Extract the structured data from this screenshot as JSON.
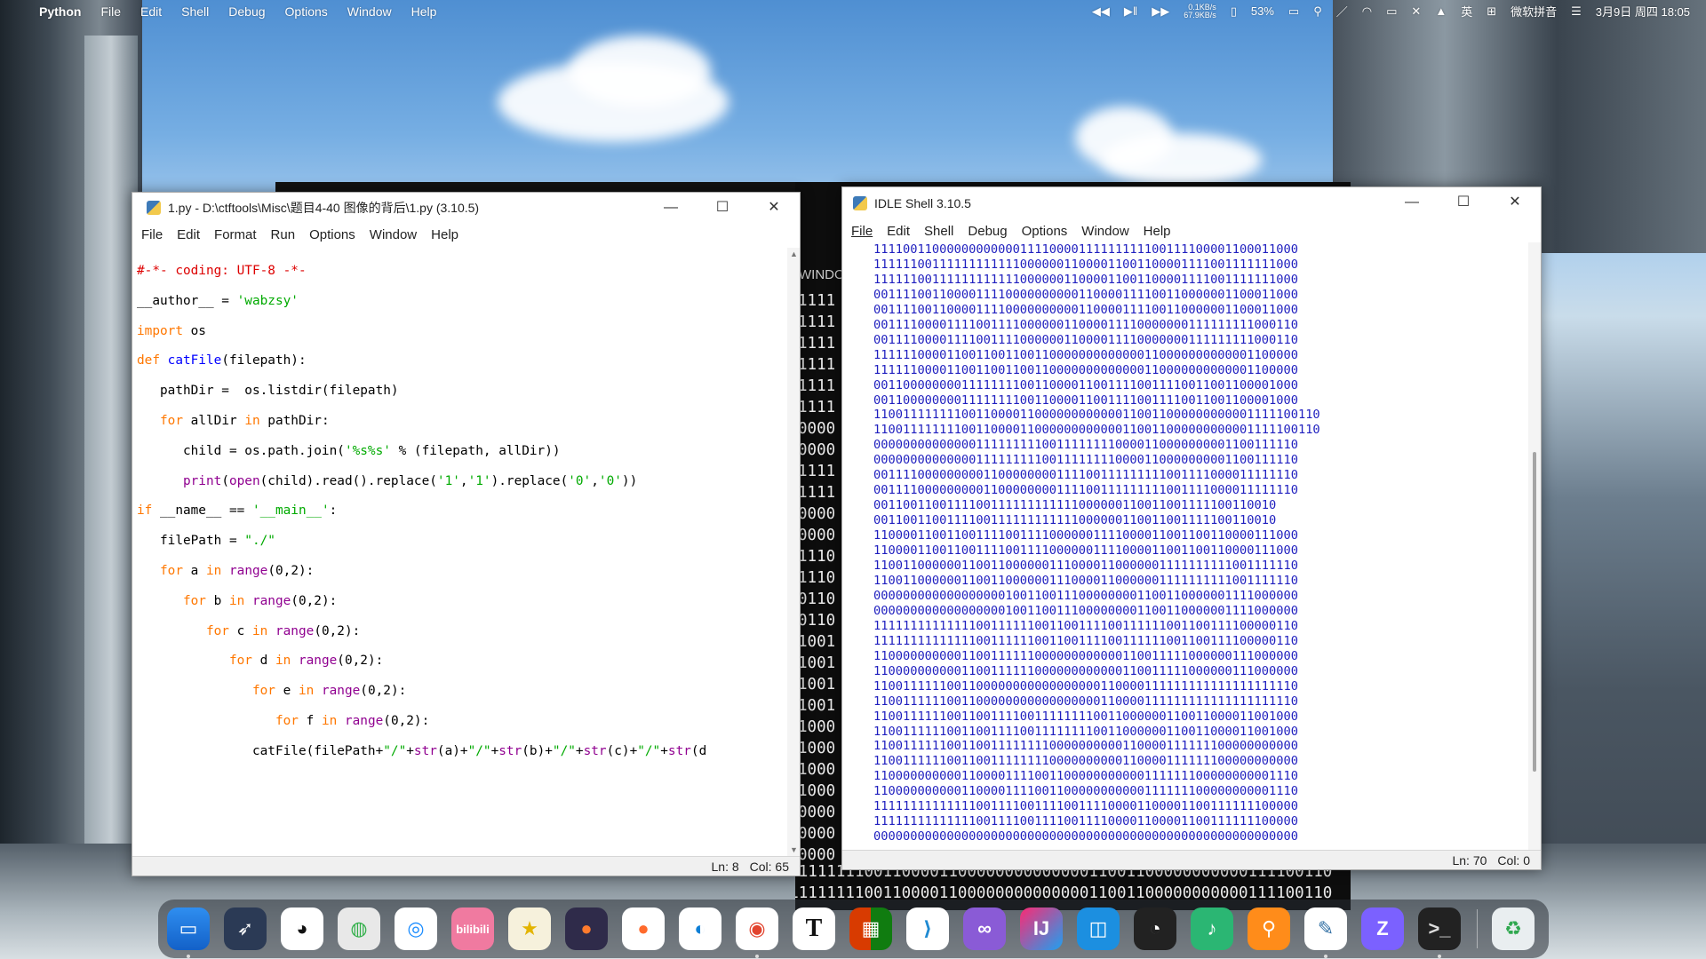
{
  "menubar": {
    "app": "Python",
    "items": [
      "File",
      "Edit",
      "Shell",
      "Debug",
      "Options",
      "Window",
      "Help"
    ],
    "net_up": "0.1KB/s",
    "net_down": "67.9KB/s",
    "battery": "53%",
    "lang": "英",
    "ime": "微软拼音",
    "datetime": "3月9日 周四 18:05"
  },
  "terminal": {
    "title": "WINDO",
    "lines": [
      "1111",
      "1111",
      "1111",
      "1111",
      "1111",
      "1111",
      "0000",
      "0000",
      "1111",
      "1111",
      "0000",
      "0000",
      "1110",
      "1110",
      "0110",
      "0110",
      "1001",
      "1001",
      "1001",
      "1001",
      "1000",
      "1000",
      "1000",
      "1000",
      "0000",
      "0000",
      "0000"
    ],
    "bottom_lines": [
      "1100111111111100110000110000000000000011001100000000000111100110",
      "1100111111111100110000110000000000000011001100000000000111100110"
    ]
  },
  "editor": {
    "title": "1.py - D:\\ctftools\\Misc\\题目4-40 图像的背后\\1.py (3.10.5)",
    "menu": [
      "File",
      "Edit",
      "Format",
      "Run",
      "Options",
      "Window",
      "Help"
    ],
    "code": {
      "l1": "#-*- coding: UTF-8 -*-",
      "l2a": "__author__ = ",
      "l2b": "'wabzsy'",
      "l3a": "import",
      "l3b": " os",
      "l4a": "def ",
      "l4b": "catFile",
      "l4c": "(filepath):",
      "l5": "   pathDir =  os.listdir(filepath)",
      "l6a": "   ",
      "l6b": "for",
      "l6c": " allDir ",
      "l6d": "in",
      "l6e": " pathDir:",
      "l7": "      child = os.path.join(",
      "l7s": "'%s%s'",
      "l7e": " % (filepath, allDir))",
      "l8a": "      ",
      "l8b": "print",
      "l8c": "(",
      "l8d": "open",
      "l8e": "(child).read().replace(",
      "l8f": "'1'",
      "l8g": ",",
      "l8h": "'1'",
      "l8i": ").replace(",
      "l8j": "'0'",
      "l8k": ",",
      "l8l": "'0'",
      "l8m": "))",
      "l9a": "if",
      "l9b": " __name__ == ",
      "l9c": "'__main__'",
      "l9d": ":",
      "l10a": "   filePath = ",
      "l10b": "\"./\"",
      "l11": "for",
      "l12": "for",
      "l13": "for",
      "l14": "for",
      "l15": "for",
      "l16": "for",
      "in": "in",
      "range": "range",
      "v11": " a ",
      "v12": " b ",
      "v13": " c ",
      "v14": " d ",
      "v15": " e ",
      "v16": " f ",
      "r": "(0,2):",
      "l17a": "               catFile(filePath+",
      "l17b": "\"/\"",
      "l17c": "+",
      "l17d": "str",
      "l17e": "(a)+",
      "l17f": "\"/\"",
      "l17g": "+",
      "l17h": "str",
      "l17i": "(b)+",
      "l17j": "\"/\"",
      "l17k": "+",
      "l17l": "str",
      "l17m": "(c)+",
      "l17n": "\"/\"",
      "l17o": "+",
      "l17p": "str",
      "l17q": "(d"
    },
    "ln": "Ln: 8",
    "col": "Col: 65"
  },
  "shell": {
    "title": "IDLE Shell 3.10.5",
    "menu": [
      "File",
      "Edit",
      "Shell",
      "Debug",
      "Options",
      "Window",
      "Help"
    ],
    "lines": [
      "1111001100000000000011110000111111111100111100001100011000",
      "1111110011111111111100000011000011001100001111001111111000",
      "1111110011111111111100000011000011001100001111001111111000",
      "0011110011000011110000000000110000111100110000001100011000",
      "0011110011000011110000000000110000111100110000001100011000",
      "0011110000111100111100000011000011110000000111111111000110",
      "0011110000111100111100000011000011110000000111111111000110",
      "1111110000110011001100110000000000000110000000000001100000",
      "1111110000110011001100110000000000000110000000000001100000",
      "0011000000001111111100110000110011110011110011001100001000",
      "0011000000001111111100110000110011110011110011001100001000",
      "1100111111110011000011000000000000110011000000000001111100110",
      "1100111111110011000011000000000000110011000000000001111100110",
      "0000000000000011111111100111111110000110000000001100111110",
      "0000000000000011111111100111111110000110000000001100111110",
      "0011110000000001100000000111100111111111001111000011111110",
      "0011110000000001100000000111100111111111001111000011111110",
      "0011001100111100111111111111000000110011001111100110010",
      "0011001100111100111111111111000000110011001111100110010",
      "1100001100110011110011110000001111000011001100110000111000",
      "1100001100110011110011110000001111000011001100110000111000",
      "1100110000001100110000001110000110000001111111111001111110",
      "1100110000001100110000001110000110000001111111111001111110",
      "0000000000000000001001100111000000001100110000001111000000",
      "0000000000000000001001100111000000001100110000001111000000",
      "1111111111111100111111001100111100111111001100111100000110",
      "1111111111111100111111001100111100111111001100111100000110",
      "1100000000001100111111000000000000110011111000000111000000",
      "1100000000001100111111000000000000110011111000000111000000",
      "1100111111001100000000000000000110000111111111111111111110",
      "1100111111001100000000000000000110000111111111111111111110",
      "1100111111001100111100111111110011000000110011000011001000",
      "1100111111001100111100111111110011000000110011000011001000",
      "1100111111001100111111110000000000110000111111100000000000",
      "1100111111001100111111110000000000110000111111100000000000",
      "1100000000001100001111001100000000000111111100000000001110",
      "1100000000001100001111001100000000000111111100000000001110",
      "1111111111111100111100111100111100001100001100111111100000",
      "1111111111111100111100111100111100001100001100111111100000",
      "0000000000000000000000000000000000000000000000000000000000"
    ],
    "ln": "Ln: 70",
    "col": "Col: 0"
  },
  "dock": [
    "finder",
    "launchpad",
    "qq",
    "wechat",
    "qq-browser",
    "bilibili",
    "notes",
    "firefox",
    "firefox-alt",
    "edge",
    "chrome",
    "typora",
    "office",
    "vscode",
    "visual-studio",
    "intellij",
    "snipaste",
    "obs",
    "music",
    "search",
    "python",
    "zed",
    "terminal",
    "recycle-bin"
  ],
  "dock_labels": {
    "bili": "bilibili",
    "typora": "T"
  }
}
